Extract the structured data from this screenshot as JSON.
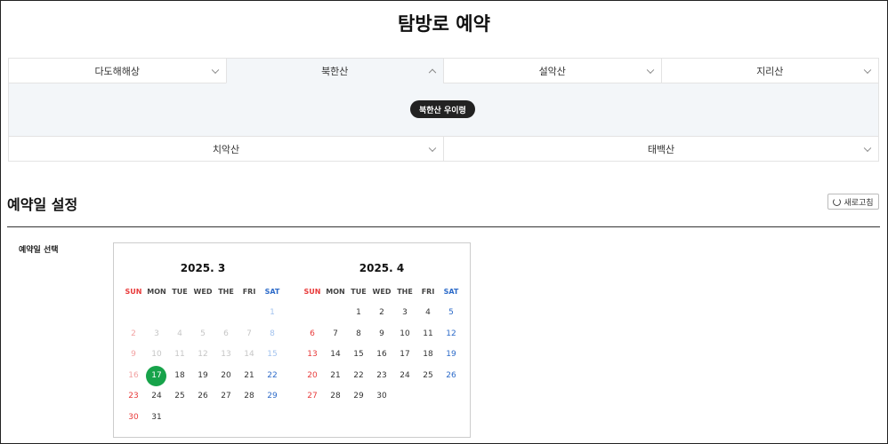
{
  "page": {
    "title": "탐방로 예약"
  },
  "mountain_tabs_row1": [
    {
      "label": "다도해해상",
      "active": false
    },
    {
      "label": "북한산",
      "active": true
    },
    {
      "label": "설악산",
      "active": false
    },
    {
      "label": "지리산",
      "active": false
    }
  ],
  "mountain_tabs_row2": [
    {
      "label": "치악산",
      "active": false
    },
    {
      "label": "태백산",
      "active": false
    }
  ],
  "sub_options": [
    "북한산 우이령"
  ],
  "reservation": {
    "section_title": "예약일 설정",
    "refresh_label": "새로고침",
    "field_label": "예약일 선택"
  },
  "calendars": [
    {
      "title": "2025. 3",
      "weekdays": [
        "SUN",
        "MON",
        "TUE",
        "WED",
        "THE",
        "FRI",
        "SAT"
      ],
      "first_weekday": 6,
      "days_in_month": 31,
      "past_until": 16,
      "selected": 17
    },
    {
      "title": "2025. 4",
      "weekdays": [
        "SUN",
        "MON",
        "TUE",
        "WED",
        "THE",
        "FRI",
        "SAT"
      ],
      "first_weekday": 2,
      "days_in_month": 30,
      "past_until": 0,
      "selected": null
    }
  ],
  "colors": {
    "selected_day": "#17a34a",
    "sunday": "#e83a3a",
    "saturday": "#2d6bc9",
    "active_tab_bg": "#f3f6f9"
  }
}
